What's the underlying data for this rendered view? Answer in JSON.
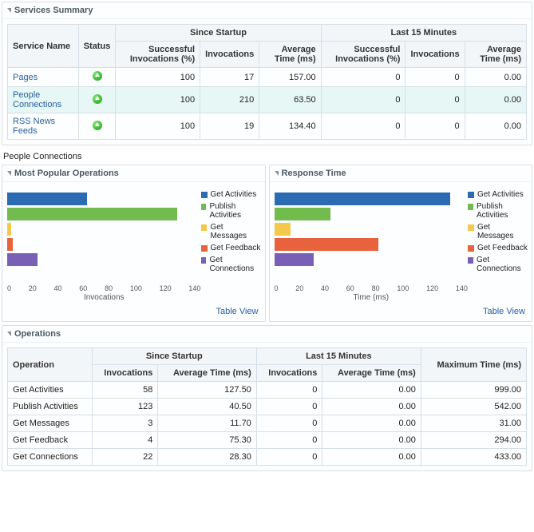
{
  "colors": {
    "get_activities": "#2a6bb2",
    "publish_activities": "#72bb4d",
    "get_messages": "#f4c84a",
    "get_feedback": "#e8623d",
    "get_connections": "#7a5fb6"
  },
  "services_summary": {
    "title": "Services Summary",
    "group_since": "Since Startup",
    "group_last15": "Last 15 Minutes",
    "col_service": "Service Name",
    "col_status": "Status",
    "col_succ": "Successful Invocations (%)",
    "col_inv": "Invocations",
    "col_avg": "Average Time (ms)",
    "rows": [
      {
        "name": "Pages",
        "succ_s": "100",
        "inv_s": "17",
        "avg_s": "157.00",
        "succ_l": "0",
        "inv_l": "0",
        "avg_l": "0.00",
        "selected": false
      },
      {
        "name": "People Connections",
        "succ_s": "100",
        "inv_s": "210",
        "avg_s": "63.50",
        "succ_l": "0",
        "inv_l": "0",
        "avg_l": "0.00",
        "selected": true
      },
      {
        "name": "RSS News Feeds",
        "succ_s": "100",
        "inv_s": "19",
        "avg_s": "134.40",
        "succ_l": "0",
        "inv_l": "0",
        "avg_l": "0.00",
        "selected": false
      }
    ]
  },
  "section_title": "People Connections",
  "chart_data": [
    {
      "type": "bar",
      "title": "Most Popular Operations",
      "xlabel": "Invocations",
      "xlim": [
        0,
        140
      ],
      "ticks": [
        "0",
        "20",
        "40",
        "60",
        "80",
        "100",
        "120",
        "140"
      ],
      "series": [
        {
          "name": "Get Activities",
          "color_key": "get_activities",
          "value": 58
        },
        {
          "name": "Publish Activities",
          "color_key": "publish_activities",
          "value": 123
        },
        {
          "name": "Get Messages",
          "color_key": "get_messages",
          "value": 3
        },
        {
          "name": "Get Feedback",
          "color_key": "get_feedback",
          "value": 4
        },
        {
          "name": "Get Connections",
          "color_key": "get_connections",
          "value": 22
        }
      ]
    },
    {
      "type": "bar",
      "title": "Response Time",
      "xlabel": "Time (ms)",
      "xlim": [
        0,
        140
      ],
      "ticks": [
        "0",
        "20",
        "40",
        "60",
        "80",
        "100",
        "120",
        "140"
      ],
      "series": [
        {
          "name": "Get Activities",
          "color_key": "get_activities",
          "value": 127.5
        },
        {
          "name": "Publish Activities",
          "color_key": "publish_activities",
          "value": 40.5
        },
        {
          "name": "Get Messages",
          "color_key": "get_messages",
          "value": 11.7
        },
        {
          "name": "Get Feedback",
          "color_key": "get_feedback",
          "value": 75.3
        },
        {
          "name": "Get Connections",
          "color_key": "get_connections",
          "value": 28.3
        }
      ]
    }
  ],
  "table_view_label": "Table View",
  "operations": {
    "title": "Operations",
    "group_since": "Since Startup",
    "group_last15": "Last 15 Minutes",
    "col_op": "Operation",
    "col_inv": "Invocations",
    "col_avg": "Average Time (ms)",
    "col_max": "Maximum Time (ms)",
    "rows": [
      {
        "name": "Get Activities",
        "inv_s": "58",
        "avg_s": "127.50",
        "inv_l": "0",
        "avg_l": "0.00",
        "max": "999.00"
      },
      {
        "name": "Publish Activities",
        "inv_s": "123",
        "avg_s": "40.50",
        "inv_l": "0",
        "avg_l": "0.00",
        "max": "542.00"
      },
      {
        "name": "Get Messages",
        "inv_s": "3",
        "avg_s": "11.70",
        "inv_l": "0",
        "avg_l": "0.00",
        "max": "31.00"
      },
      {
        "name": "Get Feedback",
        "inv_s": "4",
        "avg_s": "75.30",
        "inv_l": "0",
        "avg_l": "0.00",
        "max": "294.00"
      },
      {
        "name": "Get Connections",
        "inv_s": "22",
        "avg_s": "28.30",
        "inv_l": "0",
        "avg_l": "0.00",
        "max": "433.00"
      }
    ]
  }
}
